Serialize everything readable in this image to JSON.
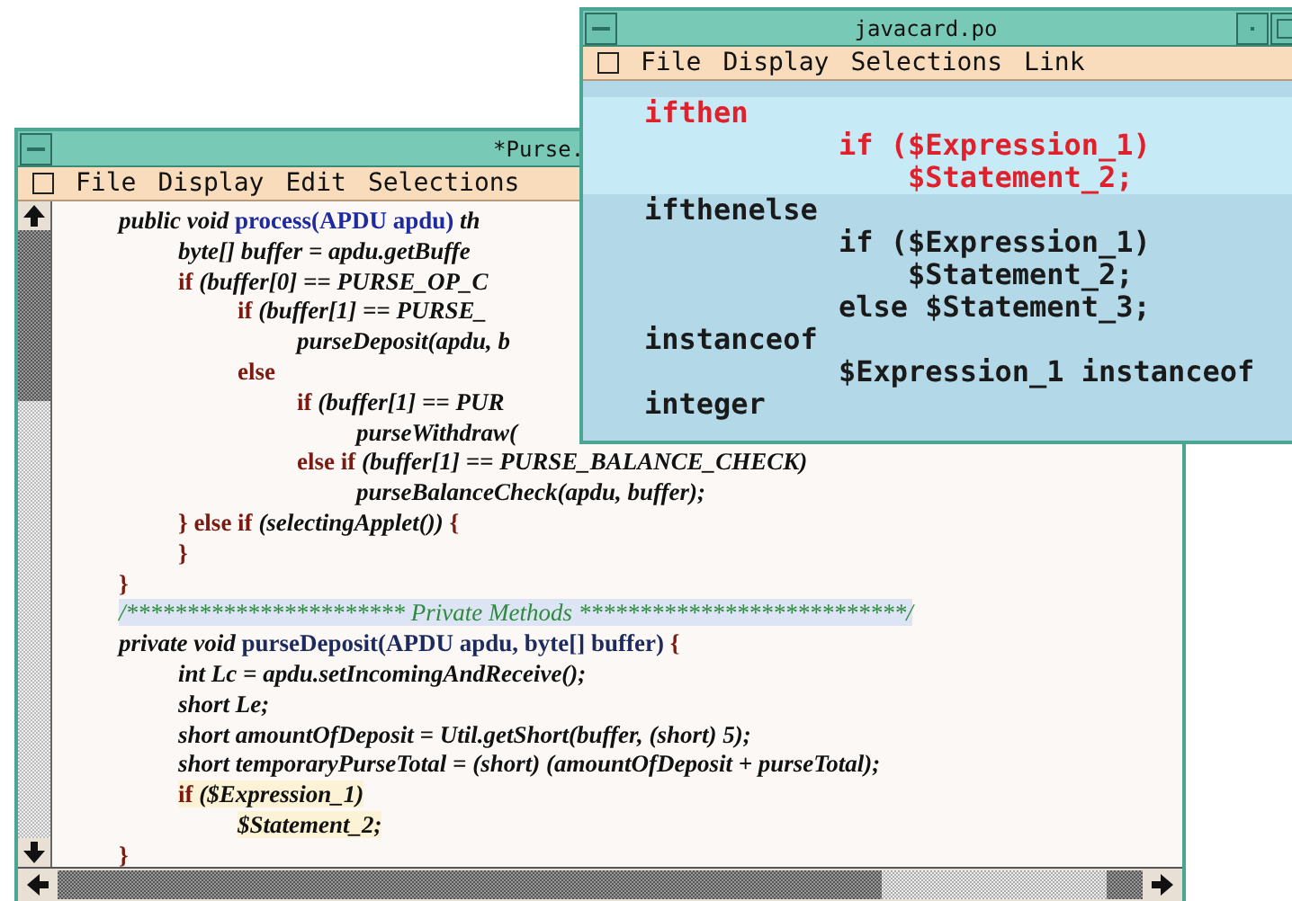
{
  "editor_window": {
    "title": "*Purse.",
    "menu": [
      "File",
      "Display",
      "Edit",
      "Selections"
    ],
    "code_lines": [
      {
        "kind": "code",
        "segments": [
          {
            "kind": "plain",
            "text": "  public void "
          },
          {
            "kind": "decl",
            "text": "process(APDU apdu)"
          },
          {
            "kind": "plain",
            "text": " th"
          }
        ]
      },
      {
        "kind": "code",
        "segments": [
          {
            "kind": "plain",
            "text": "    byte[] buffer = apdu.getBuffe"
          }
        ]
      },
      {
        "kind": "code",
        "segments": [
          {
            "kind": "kw",
            "text": "    if"
          },
          {
            "kind": "plain",
            "text": " (buffer[0] == PURSE_OP_C"
          }
        ]
      },
      {
        "kind": "code",
        "segments": [
          {
            "kind": "kw",
            "text": "      if"
          },
          {
            "kind": "plain",
            "text": " (buffer[1] == PURSE_"
          }
        ]
      },
      {
        "kind": "code",
        "segments": [
          {
            "kind": "plain",
            "text": "        purseDeposit(apdu, b"
          }
        ]
      },
      {
        "kind": "code",
        "segments": [
          {
            "kind": "kw",
            "text": "      else"
          }
        ]
      },
      {
        "kind": "code",
        "segments": [
          {
            "kind": "kw",
            "text": "        if"
          },
          {
            "kind": "plain",
            "text": " (buffer[1] == PUR"
          }
        ]
      },
      {
        "kind": "code",
        "segments": [
          {
            "kind": "plain",
            "text": "          purseWithdraw("
          }
        ]
      },
      {
        "kind": "code",
        "segments": [
          {
            "kind": "kw",
            "text": "        else if"
          },
          {
            "kind": "plain",
            "text": " (buffer[1] == PURSE_BALANCE_CHECK)"
          }
        ]
      },
      {
        "kind": "code",
        "segments": [
          {
            "kind": "plain",
            "text": "          purseBalanceCheck(apdu, buffer);"
          }
        ]
      },
      {
        "kind": "code",
        "segments": [
          {
            "kind": "kw",
            "text": "    } else if"
          },
          {
            "kind": "plain",
            "text": " (selectingApplet()) "
          },
          {
            "kind": "kw",
            "text": "{"
          }
        ]
      },
      {
        "kind": "code",
        "segments": [
          {
            "kind": "kw",
            "text": "    }"
          }
        ]
      },
      {
        "kind": "code",
        "segments": [
          {
            "kind": "kw",
            "text": "  }"
          }
        ]
      },
      {
        "kind": "comment",
        "segments": [
          {
            "kind": "comment",
            "text": "  /*********************** Private Methods ***************************/"
          }
        ]
      },
      {
        "kind": "code",
        "segments": [
          {
            "kind": "plain",
            "text": "  private void "
          },
          {
            "kind": "name",
            "text": "purseDeposit(APDU apdu, byte[] buffer)"
          },
          {
            "kind": "kw",
            "text": " {"
          }
        ]
      },
      {
        "kind": "code",
        "segments": [
          {
            "kind": "plain",
            "text": "    int Lc = apdu.setIncomingAndReceive();"
          }
        ]
      },
      {
        "kind": "code",
        "segments": [
          {
            "kind": "plain",
            "text": "    short Le;"
          }
        ]
      },
      {
        "kind": "code",
        "segments": [
          {
            "kind": "plain",
            "text": "    short amountOfDeposit = Util.getShort(buffer, (short) 5);"
          }
        ]
      },
      {
        "kind": "code",
        "segments": [
          {
            "kind": "plain",
            "text": "    short temporaryPurseTotal = (short) (amountOfDeposit + purseTotal);"
          }
        ]
      },
      {
        "kind": "template",
        "segments": [
          {
            "kind": "kw",
            "text": "    if"
          },
          {
            "kind": "plain",
            "text": " ($Expression_1)"
          }
        ]
      },
      {
        "kind": "template",
        "segments": [
          {
            "kind": "plain",
            "text": "      $Statement_2;"
          }
        ]
      },
      {
        "kind": "code",
        "segments": [
          {
            "kind": "kw",
            "text": "  }"
          }
        ]
      }
    ]
  },
  "template_window": {
    "title": "javacard.po",
    "menu": [
      "File",
      "Display",
      "Selections",
      "Link"
    ],
    "entries": [
      {
        "name": "ifthen",
        "selected": true,
        "template": [
          "if ($Expression_1)",
          "    $Statement_2;"
        ]
      },
      {
        "name": "ifthenelse",
        "selected": false,
        "template": [
          "if ($Expression_1)",
          "    $Statement_2;",
          "else $Statement_3;"
        ]
      },
      {
        "name": "instanceof",
        "selected": false,
        "template": [
          "$Expression_1 instanceof"
        ]
      },
      {
        "name": "integer",
        "selected": false
      }
    ]
  }
}
